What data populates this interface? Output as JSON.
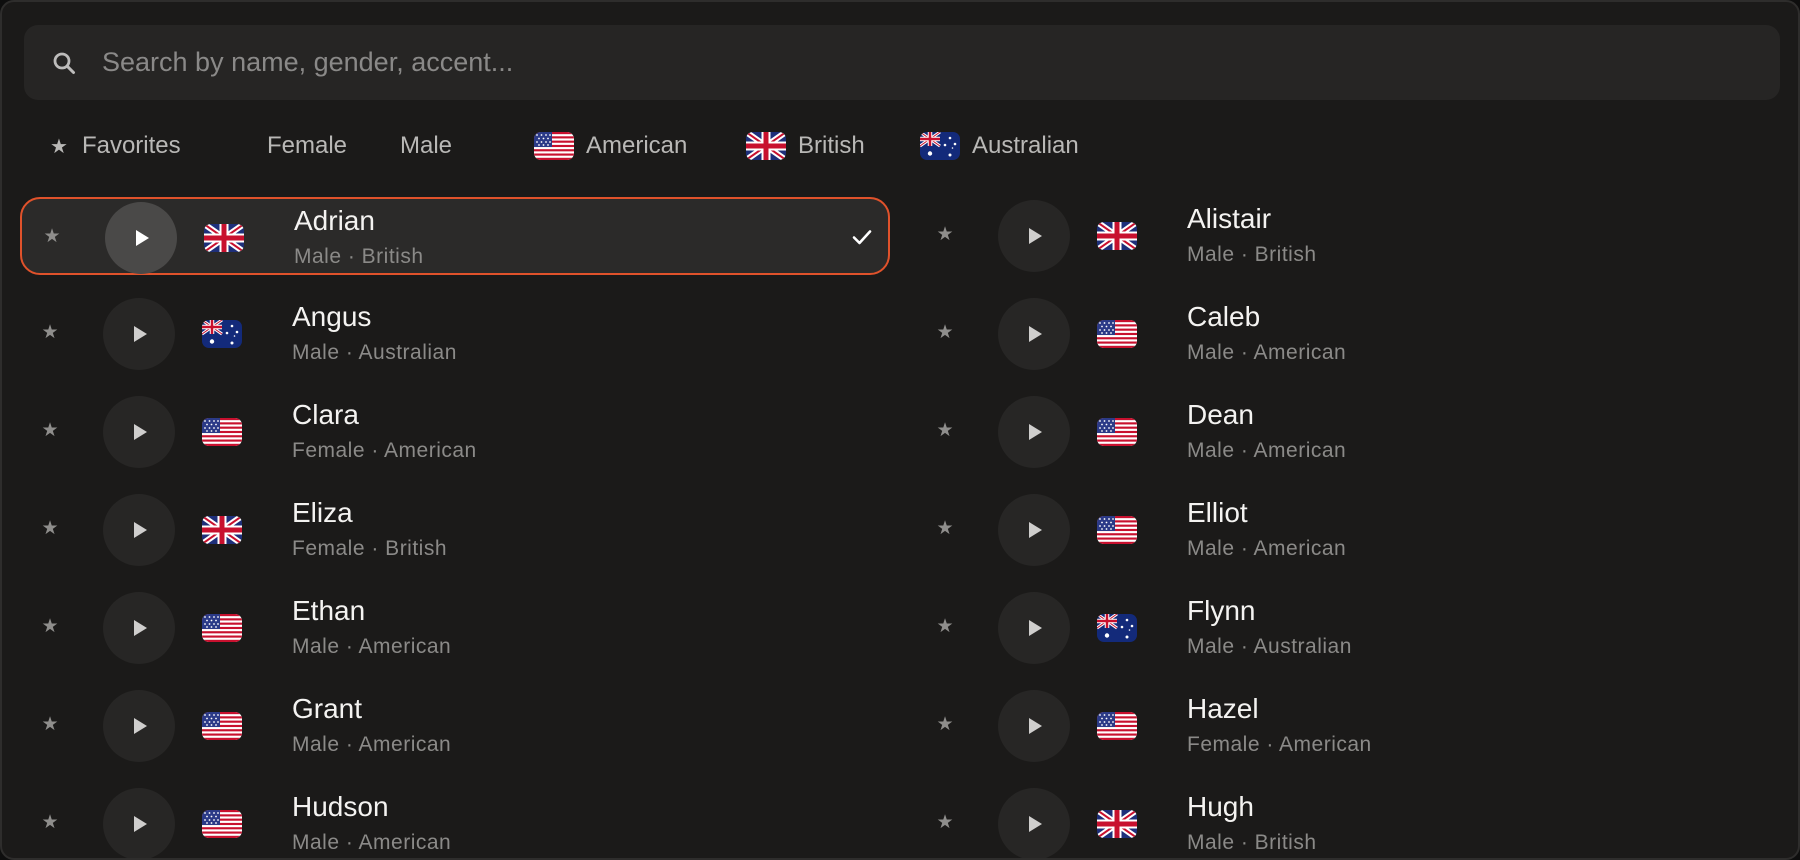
{
  "search": {
    "placeholder": "Search by name, gender, accent...",
    "value": ""
  },
  "filters": {
    "favorites": "Favorites",
    "female": "Female",
    "male": "Male",
    "american": "American",
    "british": "British",
    "australian": "Australian"
  },
  "selected_voice": "Adrian",
  "voices": [
    {
      "name": "Adrian",
      "meta": "Male · British",
      "flag": "british",
      "selected": true
    },
    {
      "name": "Alistair",
      "meta": "Male · British",
      "flag": "british"
    },
    {
      "name": "Angus",
      "meta": "Male · Australian",
      "flag": "australian"
    },
    {
      "name": "Caleb",
      "meta": "Male · American",
      "flag": "american"
    },
    {
      "name": "Clara",
      "meta": "Female · American",
      "flag": "american"
    },
    {
      "name": "Dean",
      "meta": "Male · American",
      "flag": "american"
    },
    {
      "name": "Eliza",
      "meta": "Female · British",
      "flag": "british"
    },
    {
      "name": "Elliot",
      "meta": "Male · American",
      "flag": "american"
    },
    {
      "name": "Ethan",
      "meta": "Male · American",
      "flag": "american"
    },
    {
      "name": "Flynn",
      "meta": "Male · Australian",
      "flag": "australian"
    },
    {
      "name": "Grant",
      "meta": "Male · American",
      "flag": "american"
    },
    {
      "name": "Hazel",
      "meta": "Female · American",
      "flag": "american"
    },
    {
      "name": "Hudson",
      "meta": "Male · American",
      "flag": "american"
    },
    {
      "name": "Hugh",
      "meta": "Male · British",
      "flag": "british"
    }
  ],
  "icons": {
    "search": "search-icon",
    "star": "star-icon",
    "play": "play-icon",
    "check": "check-icon"
  },
  "colors": {
    "accent": "#e0522b",
    "background": "#1b1a19",
    "text": "#f4f3f1",
    "muted": "#8b8a88"
  }
}
